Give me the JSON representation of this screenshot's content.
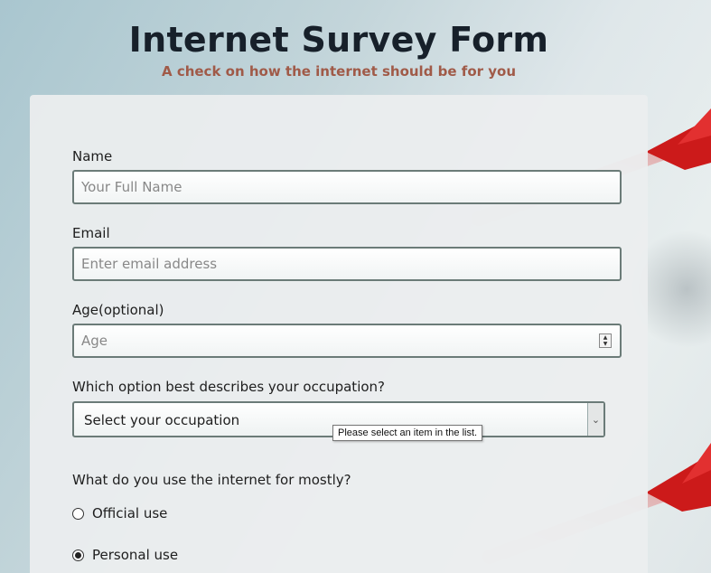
{
  "header": {
    "title": "Internet Survey Form",
    "subtitle": "A check on how the internet should be for you"
  },
  "form": {
    "name": {
      "label": "Name",
      "placeholder": "Your Full Name"
    },
    "email": {
      "label": "Email",
      "placeholder": "Enter email address"
    },
    "age": {
      "label": "Age(optional)",
      "placeholder": "Age"
    },
    "occupation": {
      "label": "Which option best describes your occupation?",
      "selected": "Select your occupation",
      "validation_tooltip": "Please select an item in the list."
    },
    "usage": {
      "label": "What do you use the internet for mostly?",
      "options": [
        {
          "label": "Official use",
          "checked": false
        },
        {
          "label": "Personal use",
          "checked": true
        }
      ]
    }
  },
  "colors": {
    "title": "#17202a",
    "subtitle": "#a05a48",
    "input_border": "#6b7b78",
    "dart_red": "#d81e1e"
  }
}
